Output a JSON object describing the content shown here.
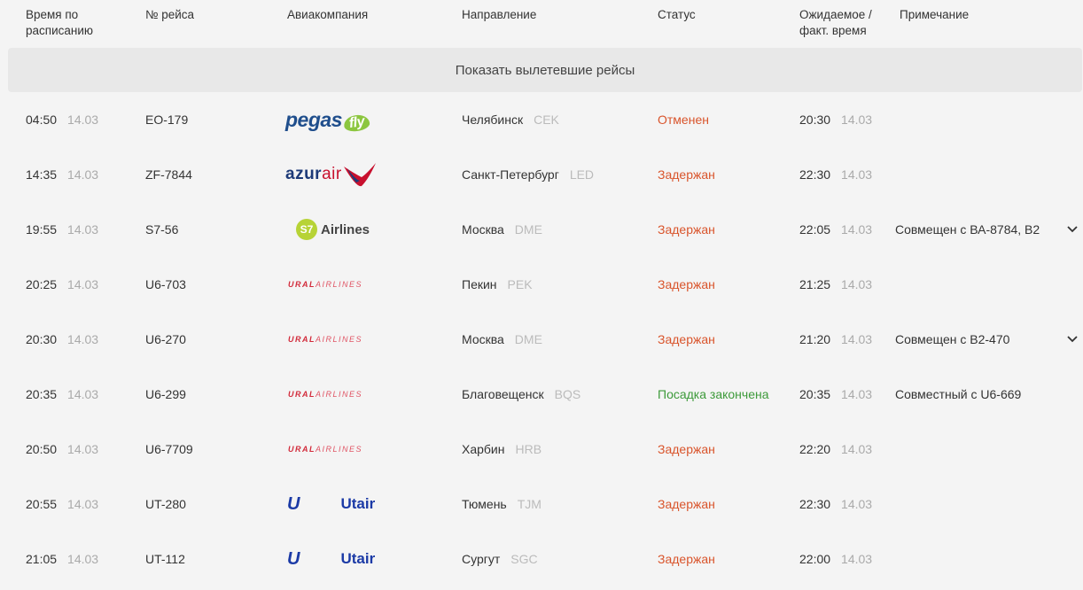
{
  "header": {
    "col_time": "Время по\nрасписанию",
    "col_flight": "№ рейса",
    "col_airline": "Авиакомпания",
    "col_direction": "Направление",
    "col_status": "Статус",
    "col_expected": "Ожидаемое /\nфакт. время",
    "col_note": "Примечание"
  },
  "show_departed_label": "Показать вылетевшие рейсы",
  "colors": {
    "delayed": "#d9542b",
    "boarding_done": "#3d9a3a",
    "background": "#f4f4f4"
  },
  "flights": [
    {
      "time": "04:50",
      "date": "14.03",
      "flight": "EO-179",
      "airline": "pegas-fly",
      "city": "Челябинск",
      "code": "CEK",
      "status": "Отменен",
      "status_type": "red",
      "exp_time": "20:30",
      "exp_date": "14.03",
      "note": "",
      "has_chevron": false
    },
    {
      "time": "14:35",
      "date": "14.03",
      "flight": "ZF-7844",
      "airline": "azur-air",
      "city": "Санкт-Петербург",
      "code": "LED",
      "status": "Задержан",
      "status_type": "red",
      "exp_time": "22:30",
      "exp_date": "14.03",
      "note": "",
      "has_chevron": false
    },
    {
      "time": "19:55",
      "date": "14.03",
      "flight": "S7-56",
      "airline": "s7-airlines",
      "city": "Москва",
      "code": "DME",
      "status": "Задержан",
      "status_type": "red",
      "exp_time": "22:05",
      "exp_date": "14.03",
      "note": "Совмещен с ВА-8784, B2",
      "has_chevron": true
    },
    {
      "time": "20:25",
      "date": "14.03",
      "flight": "U6-703",
      "airline": "ural-airlines",
      "city": "Пекин",
      "code": "PEK",
      "status": "Задержан",
      "status_type": "red",
      "exp_time": "21:25",
      "exp_date": "14.03",
      "note": "",
      "has_chevron": false
    },
    {
      "time": "20:30",
      "date": "14.03",
      "flight": "U6-270",
      "airline": "ural-airlines",
      "city": "Москва",
      "code": "DME",
      "status": "Задержан",
      "status_type": "red",
      "exp_time": "21:20",
      "exp_date": "14.03",
      "note": "Совмещен с B2-470",
      "has_chevron": true
    },
    {
      "time": "20:35",
      "date": "14.03",
      "flight": "U6-299",
      "airline": "ural-airlines",
      "city": "Благовещенск",
      "code": "BQS",
      "status": "Посадка закончена",
      "status_type": "green",
      "exp_time": "20:35",
      "exp_date": "14.03",
      "note": "Совместный с U6-669",
      "has_chevron": false
    },
    {
      "time": "20:50",
      "date": "14.03",
      "flight": "U6-7709",
      "airline": "ural-airlines",
      "city": "Харбин",
      "code": "HRB",
      "status": "Задержан",
      "status_type": "red",
      "exp_time": "22:20",
      "exp_date": "14.03",
      "note": "",
      "has_chevron": false
    },
    {
      "time": "20:55",
      "date": "14.03",
      "flight": "UT-280",
      "airline": "utair",
      "city": "Тюмень",
      "code": "TJM",
      "status": "Задержан",
      "status_type": "red",
      "exp_time": "22:30",
      "exp_date": "14.03",
      "note": "",
      "has_chevron": false
    },
    {
      "time": "21:05",
      "date": "14.03",
      "flight": "UT-112",
      "airline": "utair",
      "city": "Сургут",
      "code": "SGC",
      "status": "Задержан",
      "status_type": "red",
      "exp_time": "22:00",
      "exp_date": "14.03",
      "note": "",
      "has_chevron": false
    }
  ],
  "logos": {
    "pegas-fly": {
      "main": "pegas",
      "accent": "fly"
    },
    "azur-air": {
      "main": "azur",
      "accent": "air"
    },
    "s7-airlines": {
      "badge": "S7",
      "text": "Airlines"
    },
    "ural-airlines": {
      "main": "URAL",
      "accent": "AIRLINES"
    },
    "utair": {
      "mark": "U",
      "text": "Utair"
    }
  }
}
